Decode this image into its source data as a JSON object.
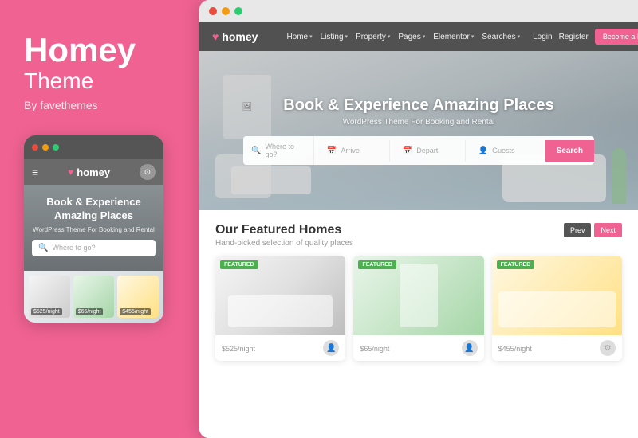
{
  "left": {
    "title_line1": "Homey",
    "title_line2": "Theme",
    "author": "By favethemes",
    "mobile": {
      "dot_colors": [
        "#e74c3c",
        "#f39c12",
        "#2ecc71"
      ],
      "logo": "homey",
      "hero_title": "Book & Experience Amazing Places",
      "hero_subtitle": "WordPress Theme For Booking and Rental",
      "search_placeholder": "Where to go?",
      "cards": [
        {
          "price": "$525",
          "unit": "/night"
        },
        {
          "price": "$65",
          "unit": "/night"
        },
        {
          "price": "$455",
          "unit": "/night"
        }
      ]
    }
  },
  "right": {
    "dot_colors": [
      "#e74c3c",
      "#f39c12",
      "#2ecc71"
    ],
    "navbar": {
      "logo": "homey",
      "links": [
        {
          "label": "Home",
          "has_dropdown": true
        },
        {
          "label": "Listing",
          "has_dropdown": true
        },
        {
          "label": "Property",
          "has_dropdown": true
        },
        {
          "label": "Pages",
          "has_dropdown": true
        },
        {
          "label": "Elementor",
          "has_dropdown": true
        },
        {
          "label": "Searches",
          "has_dropdown": true
        },
        {
          "label": "Login",
          "has_dropdown": false
        },
        {
          "label": "Register",
          "has_dropdown": false
        }
      ],
      "become_host": "Become a Host"
    },
    "hero": {
      "title": "Book & Experience Amazing Places",
      "subtitle": "WordPress Theme For Booking and Rental",
      "search": {
        "field1": "Where to go?",
        "field2": "Arrive",
        "field3": "Depart",
        "field4": "Guests",
        "button": "Search"
      }
    },
    "featured": {
      "title": "Our Featured Homes",
      "desc": "Hand-picked selection of quality places",
      "nav_prev": "Prev",
      "nav_next": "Next",
      "cards": [
        {
          "badge": "FEATURED",
          "price": "$525",
          "unit": "/night",
          "has_avatar": true
        },
        {
          "badge": "FEATURED",
          "price": "$65",
          "unit": "/night",
          "has_avatar": true
        },
        {
          "badge": "FEATURED",
          "price": "$455",
          "unit": "/night",
          "has_avatar": true
        }
      ]
    }
  },
  "colors": {
    "pink": "#f06292",
    "dot_red": "#e74c3c",
    "dot_yellow": "#f39c12",
    "dot_green": "#2ecc71"
  }
}
